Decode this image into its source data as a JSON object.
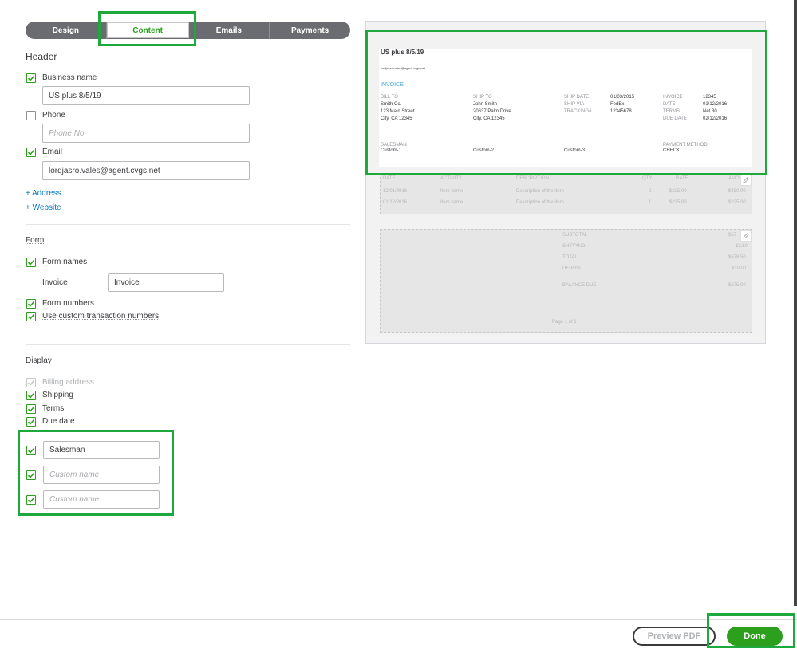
{
  "tabs": [
    {
      "label": "Design"
    },
    {
      "label": "Content"
    },
    {
      "label": "Emails"
    },
    {
      "label": "Payments"
    }
  ],
  "header": {
    "title": "Header",
    "business_name": {
      "label": "Business name",
      "checked": true,
      "value": "US plus 8/5/19"
    },
    "phone": {
      "label": "Phone",
      "checked": false,
      "placeholder": "Phone No"
    },
    "email": {
      "label": "Email",
      "checked": true,
      "value": "lordjasro.vales@agent.cvgs.net"
    },
    "add_address": "+ Address",
    "add_website": "+ Website"
  },
  "form": {
    "title": "Form",
    "form_names": {
      "label": "Form names",
      "checked": true
    },
    "invoice_label": "Invoice",
    "invoice_value": "Invoice",
    "form_numbers": {
      "label": "Form numbers",
      "checked": true
    },
    "custom_numbers": {
      "label": "Use custom transaction numbers",
      "checked": true
    }
  },
  "display": {
    "title": "Display",
    "billing_address": "Billing address",
    "shipping": "Shipping",
    "terms": "Terms",
    "due_date": "Due date",
    "custom_fields": [
      {
        "value": "Salesman",
        "placeholder": "Custom name"
      },
      {
        "value": "",
        "placeholder": "Custom name"
      },
      {
        "value": "",
        "placeholder": "Custom name"
      }
    ]
  },
  "preview": {
    "company": "US plus 8/5/19",
    "email": "lordjasro.vales@agent.cvgs.net",
    "doc_title": "INVOICE",
    "bill_to": {
      "label": "BILL TO",
      "lines": [
        "Smith Co.",
        "123 Main Street",
        "City, CA 12345"
      ]
    },
    "ship_to": {
      "label": "SHIP TO",
      "lines": [
        "John Smith",
        "20637 Palm Drive",
        "City, CA 12345"
      ]
    },
    "ship_info": {
      "labels": [
        "SHIP DATE",
        "SHIP VIA",
        "TRACKING#"
      ],
      "values": [
        "01/03/2015",
        "FedEx",
        "12345678"
      ]
    },
    "inv_info": {
      "labels": [
        "INVOICE",
        "DATE",
        "TERMS",
        "DUE DATE"
      ],
      "values": [
        "12345",
        "01/12/2016",
        "Net 30",
        "02/12/2016"
      ]
    },
    "salesman_label": "SALESMAN",
    "custom1": "Custom-1",
    "custom2": "Custom-2",
    "custom3": "Custom-3",
    "payment_label": "PAYMENT METHOD",
    "payment_value": "CHECK",
    "table_headers": [
      "DATE",
      "ACTIVITY",
      "DESCRIPTION",
      "QTY",
      "RATE",
      "AMO"
    ],
    "rows": [
      {
        "date": "12/01/2016",
        "activity": "Item name",
        "desc": "Description of the item",
        "qty": "2",
        "rate": "$225.00",
        "amount": "$450.00"
      },
      {
        "date": "01/12/2016",
        "activity": "Item name",
        "desc": "Description of the item",
        "qty": "1",
        "rate": "$225.00",
        "amount": "$225.00"
      }
    ],
    "totals": {
      "subtotal_label": "SUBTOTAL",
      "subtotal": "$67",
      "shipping_label": "SHIPPING",
      "shipping": "$3.50",
      "total_label": "TOTAL",
      "total": "$678.50",
      "deposit_label": "DEPOSIT",
      "deposit": "$10.00",
      "balance_label": "BALANCE DUE",
      "balance": "$675.00"
    },
    "page_label": "Page 1 of 1"
  },
  "footer": {
    "preview_pdf": "Preview PDF",
    "done": "Done"
  },
  "colors": {
    "accent": "#2ca01c",
    "highlight": "#1fa83c",
    "link": "#0077c5",
    "tab_bg": "#6b6c72"
  }
}
